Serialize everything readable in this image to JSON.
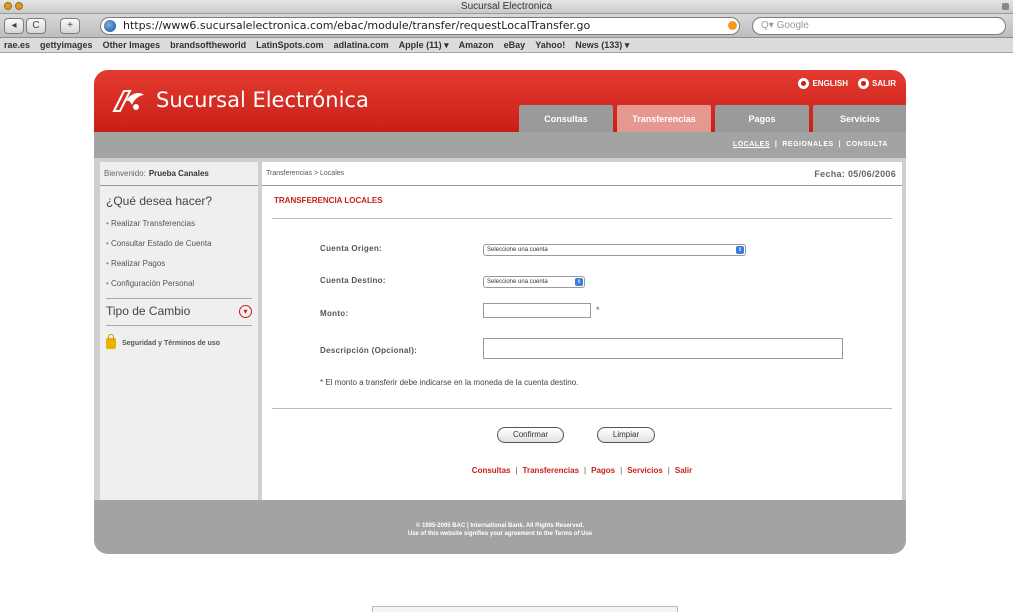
{
  "browser": {
    "window_title": "Sucursal Electronica",
    "back": "◂",
    "forward": "▸",
    "reload": "C",
    "add": "+",
    "url": "https://www6.sucursalelectronica.com/ebac/module/transfer/requestLocalTransfer.go",
    "search_placeholder": "Q▾ Google",
    "bookmarks": [
      "rae.es",
      "gettyimages",
      "Other Images",
      "brandsoftheworld",
      "LatinSpots.com",
      "adlatina.com",
      "Apple (11) ▾",
      "Amazon",
      "eBay",
      "Yahoo!",
      "News (133) ▾"
    ]
  },
  "site": {
    "logo": "Sucursal Electrónica",
    "lang_english": "ENGLISH",
    "lang_salir": "SALIR",
    "tabs": [
      "Consultas",
      "Transferencias",
      "Pagos",
      "Servicios"
    ],
    "active_tab": "Transferencias",
    "subnav": [
      "LOCALES",
      "REGIONALES",
      "CONSULTA"
    ],
    "sidebar": {
      "welcome_label": "Bienvenido:",
      "welcome_user": "Prueba Canales",
      "que_title": "¿Qué desea hacer?",
      "links": [
        "Realizar Transferencias",
        "Consultar Estado de Cuenta",
        "Realizar Pagos",
        "Configuración Personal"
      ],
      "tipo_cambio": "Tipo de Cambio",
      "seguridad": "Seguridad y Términos de uso"
    },
    "main": {
      "breadcrumb": "Transferencias > Locales",
      "fecha": "Fecha: 05/06/2006",
      "section_title": "TRANSFERENCIA LOCALES",
      "cuenta_origen_label": "Cuenta Origen:",
      "cuenta_origen_value": "Seleccione una cuenta",
      "cuenta_destino_label": "Cuenta Destino:",
      "cuenta_destino_value": "Seleccione una cuenta",
      "monto_label": "Monto:",
      "required_mark": "*",
      "descripcion_label": "Descripción (Opcional):",
      "note": "* El monto a transferir debe indicarse en la moneda de la cuenta destino.",
      "confirm_button": "Confirmar",
      "clear_button": "Limpiar",
      "footer_links": [
        "Consultas",
        "Transferencias",
        "Pagos",
        "Servicios",
        "Salir"
      ]
    },
    "copyright_line1": "© 1995-2005 BAC | International Bank. All Rights Reserved.",
    "copyright_line2": "Use of this website signifies your agreement to the Terms of Use"
  },
  "colors": {
    "brand_red": "#c81f17",
    "tab_gray": "#9a9a9a",
    "tab_active": "#e6978f"
  }
}
